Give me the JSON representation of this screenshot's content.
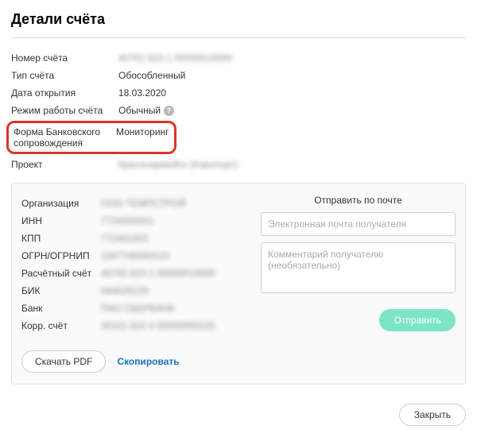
{
  "title": "Детали счёта",
  "details": {
    "account_number_label": "Номер счёта",
    "account_number_value": "40702 810 1 00000010000",
    "account_type_label": "Тип счёта",
    "account_type_value": "Обособленный",
    "open_date_label": "Дата открытия",
    "open_date_value": "18.03.2020",
    "mode_label": "Режим работы счёта",
    "mode_value": "Обычный",
    "bank_support_label": "Форма Банковского сопровождения",
    "bank_support_value": "Мониторинг",
    "project_label": "Проект",
    "project_value": "Красноармейск (Аэропорт)"
  },
  "org": {
    "org_label": "Организация",
    "org_value": "ООО ТЕМПСТРОЙ",
    "inn_label": "ИНН",
    "inn_value": "7724000001",
    "kpp_label": "КПП",
    "kpp_value": "772401001",
    "ogrn_label": "ОГРН/ОГРНИП",
    "ogrn_value": "1187746000123",
    "acc_label": "Расчётный счёт",
    "acc_value": "40702 810 1 00000010000",
    "bik_label": "БИК",
    "bik_value": "044525225",
    "bank_label": "Банк",
    "bank_value": "ПАО СБЕРБАНК",
    "corr_label": "Корр. счёт",
    "corr_value": "30101 810 4 00000000225"
  },
  "send": {
    "title": "Отправить по почте",
    "email_placeholder": "Электронная почта получателя",
    "comment_placeholder": "Комментарий получателю (необязательно)",
    "button": "Отправить"
  },
  "actions": {
    "pdf": "Скачать PDF",
    "copy": "Скопировать",
    "close": "Закрыть"
  }
}
